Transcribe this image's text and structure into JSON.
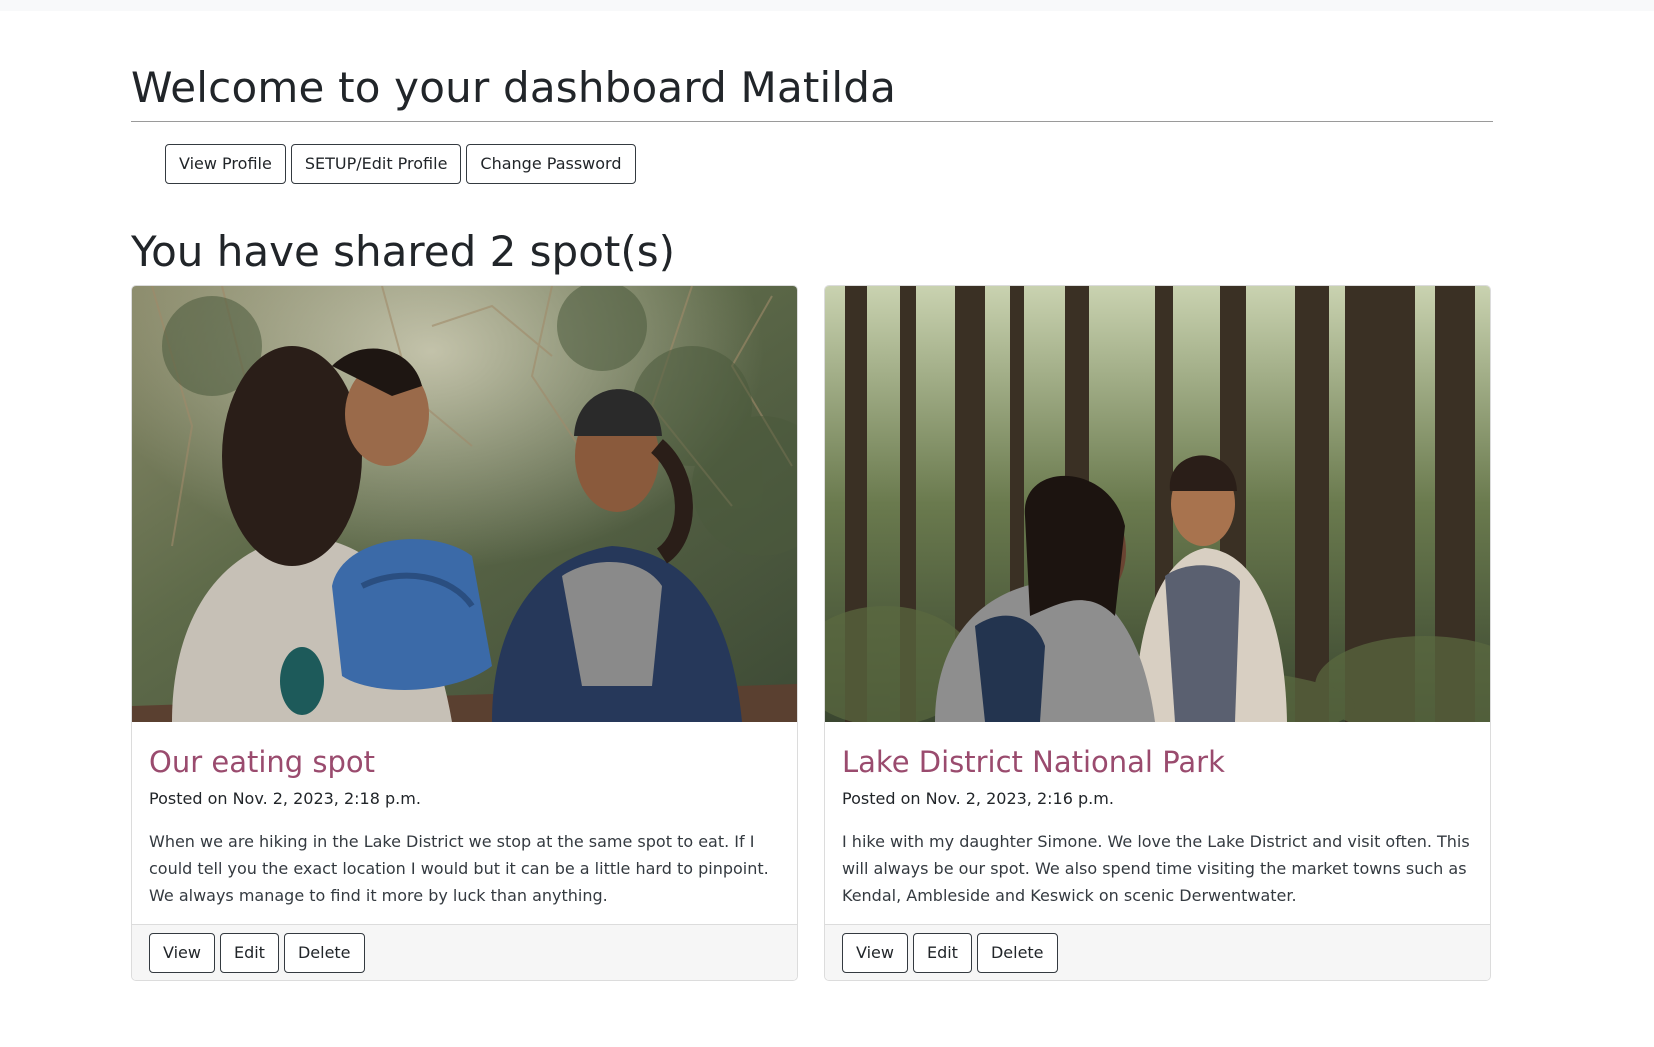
{
  "dashboard": {
    "title": "Welcome to your dashboard Matilda",
    "profile_buttons": {
      "view_profile": "View Profile",
      "edit_profile": "SETUP/Edit Profile",
      "change_password": "Change Password"
    },
    "shared_heading": "You have shared 2 spot(s)"
  },
  "spots": [
    {
      "title": "Our eating spot",
      "posted": "Posted on Nov. 2, 2023, 2:18 p.m.",
      "description": "When we are hiking in the Lake District we stop at the same spot to eat. If I could tell you the exact location I would but it can be a little hard to pinpoint. We always manage to find it more by luck than anything.",
      "image_alt": "Two women hikers laughing at a picnic table in a forest",
      "actions": {
        "view": "View",
        "edit": "Edit",
        "delete": "Delete"
      }
    },
    {
      "title": "Lake District National Park",
      "posted": "Posted on Nov. 2, 2023, 2:16 p.m.",
      "description": "I hike with my daughter Simone. We love the Lake District and visit often. This will always be our spot. We also spend time visiting the market towns such as Kendal, Ambleside and Keswick on scenic Derwentwater.",
      "image_alt": "Two women hiking through a tall forest",
      "actions": {
        "view": "View",
        "edit": "Edit",
        "delete": "Delete"
      }
    }
  ],
  "colors": {
    "card_title": "#9a4b6e",
    "button_border": "#343a40",
    "footer_bg": "#f6f6f6"
  }
}
